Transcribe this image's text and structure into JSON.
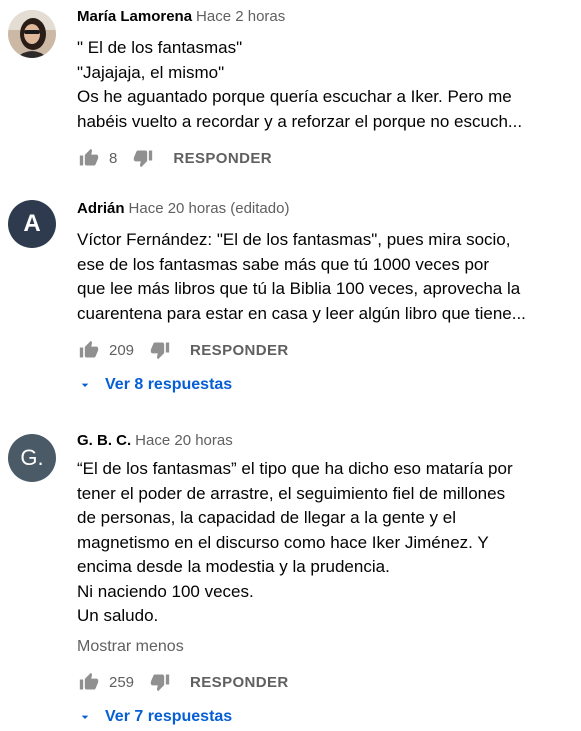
{
  "comments": [
    {
      "author": "María Lamorena",
      "time": "Hace 2 horas",
      "avatar_type": "photo",
      "lines": [
        "\" El de los fantasmas\"",
        "\"Jajajaja, el mismo\"",
        "Os he aguantado porque quería escuchar a Iker. Pero me",
        "habéis vuelto a recordar y a reforzar el porque no escuch..."
      ],
      "likes": "8",
      "reply_label": "RESPONDER"
    },
    {
      "author": "Adrián",
      "time": "Hace 20 horas (editado)",
      "avatar_type": "letter",
      "avatar_letter": "A",
      "avatar_color": "#2e3b4e",
      "lines": [
        "Víctor Fernández: \"El de los fantasmas\", pues mira socio,",
        "ese de los fantasmas sabe más que tú 1000 veces por",
        "que lee más libros que tú la Biblia 100 veces, aprovecha la",
        "cuarentena para estar en casa y leer algún libro que tiene..."
      ],
      "likes": "209",
      "reply_label": "RESPONDER",
      "view_replies": "Ver 8 respuestas"
    },
    {
      "author": "G. B. C.",
      "time": "Hace 20 horas",
      "avatar_type": "letter",
      "avatar_letter": "G.",
      "avatar_color": "#4a5a66",
      "lines": [
        "“El de los fantasmas” el tipo que ha dicho eso mataría por",
        "tener el poder de arrastre, el seguimiento fiel de millones",
        "de personas, la capacidad de llegar a la gente y el",
        "magnetismo en el discurso como hace Iker Jiménez. Y",
        "encima desde la modestia y la prudencia.",
        "Ni naciendo 100 veces.",
        "Un saludo."
      ],
      "show_less": "Mostrar menos",
      "likes": "259",
      "reply_label": "RESPONDER",
      "view_replies": "Ver 7 respuestas"
    }
  ],
  "icons": {
    "like": "thumb-up-icon",
    "dislike": "thumb-down-icon",
    "expand": "chevron-down-icon"
  },
  "colors": {
    "link": "#065fd4",
    "secondary_text": "#606060",
    "icon": "#909090"
  }
}
